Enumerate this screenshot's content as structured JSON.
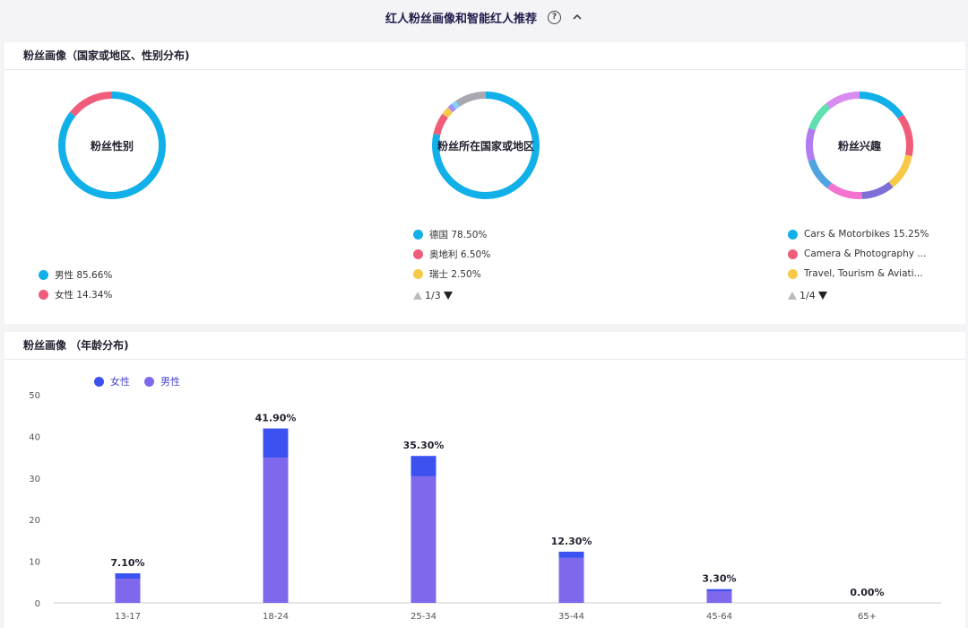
{
  "header": {
    "title": "红人粉丝画像和智能红人推荐",
    "help_icon": "?"
  },
  "profile_card": {
    "title": "粉丝画像（国家或地区、性别分布)",
    "donuts": [
      {
        "label": "粉丝性别",
        "segments": [
          {
            "name": "男性",
            "value": 85.66,
            "color": "#12b0e8"
          },
          {
            "name": "女性",
            "value": 14.34,
            "color": "#f05d7b"
          }
        ],
        "legend": [
          {
            "text": "男性 85.66%",
            "color": "#12b0e8"
          },
          {
            "text": "女性 14.34%",
            "color": "#f05d7b"
          }
        ]
      },
      {
        "label": "粉丝所在国家或地区",
        "segments": [
          {
            "name": "德国",
            "value": 78.5,
            "color": "#12b0e8"
          },
          {
            "name": "奥地利",
            "value": 6.5,
            "color": "#f05d7b"
          },
          {
            "name": "瑞士",
            "value": 2.5,
            "color": "#f7c948"
          },
          {
            "name": "",
            "value": 1.5,
            "color": "#a78bfa"
          },
          {
            "name": "",
            "value": 1.5,
            "color": "#7dd3fc"
          },
          {
            "name": "",
            "value": 9.5,
            "color": "#a8a8b0"
          }
        ],
        "legend": [
          {
            "text": "德国 78.50%",
            "color": "#12b0e8"
          },
          {
            "text": "奥地利 6.50%",
            "color": "#f05d7b"
          },
          {
            "text": "瑞士 2.50%",
            "color": "#f7c948"
          }
        ],
        "pager": "1/3"
      },
      {
        "label": "粉丝兴趣",
        "segments": [
          {
            "name": "Cars & Motorbikes",
            "value": 15.25,
            "color": "#12b0e8"
          },
          {
            "name": "Camera & Photography",
            "value": 13,
            "color": "#f05d7b"
          },
          {
            "name": "Travel, Tourism & Aviation",
            "value": 11,
            "color": "#f7c948"
          },
          {
            "name": "",
            "value": 10,
            "color": "#7c6fd6"
          },
          {
            "name": "",
            "value": 11,
            "color": "#f472d0"
          },
          {
            "name": "",
            "value": 10,
            "color": "#4fa3e0"
          },
          {
            "name": "",
            "value": 10,
            "color": "#b07cf0"
          },
          {
            "name": "",
            "value": 9,
            "color": "#5ee0b0"
          },
          {
            "name": "",
            "value": 10.75,
            "color": "#d98cf0"
          }
        ],
        "legend": [
          {
            "text": "Cars & Motorbikes 15.25%",
            "color": "#12b0e8"
          },
          {
            "text": "Camera & Photography ...",
            "color": "#f05d7b"
          },
          {
            "text": "Travel, Tourism & Aviati...",
            "color": "#f7c948"
          }
        ],
        "pager": "1/4"
      }
    ]
  },
  "age_card": {
    "title": "粉丝画像 （年龄分布)",
    "legend": [
      {
        "text": "女性",
        "color": "#3b52f0"
      },
      {
        "text": "男性",
        "color": "#8068ec"
      }
    ]
  },
  "chart_data": {
    "type": "bar",
    "stacked": true,
    "categories": [
      "13-17",
      "18-24",
      "25-34",
      "35-44",
      "45-64",
      "65+"
    ],
    "series": [
      {
        "name": "男性",
        "color": "#8068ec",
        "values": [
          5.8,
          34.9,
          30.4,
          10.8,
          2.8,
          0
        ]
      },
      {
        "name": "女性",
        "color": "#3b52f0",
        "values": [
          1.3,
          7.0,
          4.9,
          1.5,
          0.5,
          0
        ]
      }
    ],
    "totals_labels": [
      "7.10%",
      "41.90%",
      "35.30%",
      "12.30%",
      "3.30%",
      "0.00%"
    ],
    "totals": [
      7.1,
      41.9,
      35.3,
      12.3,
      3.3,
      0
    ],
    "ylim": [
      0,
      50
    ],
    "yticks": [
      0,
      10,
      20,
      30,
      40,
      50
    ]
  }
}
